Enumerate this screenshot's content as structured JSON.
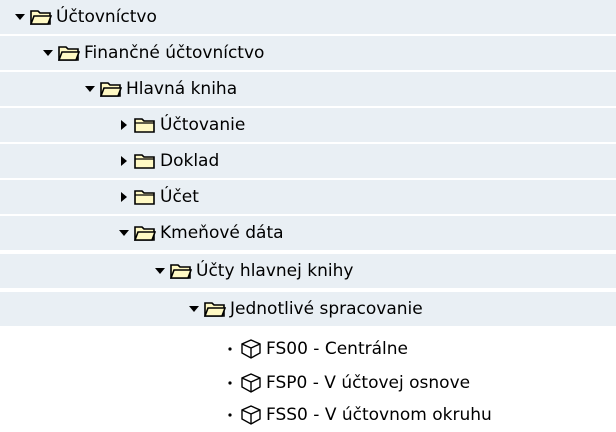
{
  "tree": {
    "nodes": [
      {
        "label": "Účtovníctvo",
        "state": "expanded",
        "icon": "folder-open-icon"
      },
      {
        "label": "Finančné účtovníctvo",
        "state": "expanded",
        "icon": "folder-open-icon"
      },
      {
        "label": "Hlavná kniha",
        "state": "expanded",
        "icon": "folder-open-icon"
      },
      {
        "label": "Účtovanie",
        "state": "collapsed",
        "icon": "folder-closed-icon"
      },
      {
        "label": "Doklad",
        "state": "collapsed",
        "icon": "folder-closed-icon"
      },
      {
        "label": "Účet",
        "state": "collapsed",
        "icon": "folder-closed-icon"
      },
      {
        "label": "Kmeňové dáta",
        "state": "expanded",
        "icon": "folder-open-icon"
      },
      {
        "label": "Účty hlavnej knihy",
        "state": "expanded",
        "icon": "folder-open-icon"
      },
      {
        "label": "Jednotlivé spracovanie",
        "state": "expanded",
        "icon": "folder-open-icon"
      },
      {
        "label": "FS00 - Centrálne",
        "state": "leaf",
        "icon": "transaction-cube-icon"
      },
      {
        "label": "FSP0 - V účtovej osnove",
        "state": "leaf",
        "icon": "transaction-cube-icon"
      },
      {
        "label": "FSS0 - V účtovnom okruhu",
        "state": "leaf",
        "icon": "transaction-cube-icon"
      }
    ]
  },
  "colors": {
    "row_shade": "#e9eff4",
    "folder_fill": "#fff9c4",
    "folder_stroke": "#000000"
  }
}
